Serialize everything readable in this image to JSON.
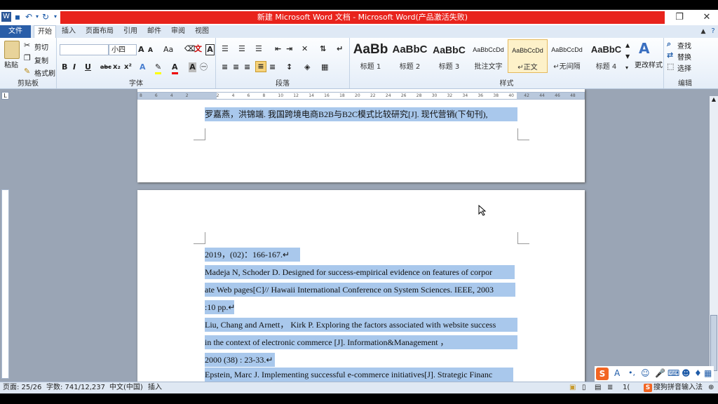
{
  "window": {
    "title": "新建 Microsoft Word 文档 - Microsoft Word(产品激活失败)",
    "restore_icon": "restore-icon",
    "close_icon": "close-icon"
  },
  "ribbon_tabs": [
    "文件",
    "开始",
    "插入",
    "页面布局",
    "引用",
    "邮件",
    "审阅",
    "视图"
  ],
  "clipboard": {
    "paste": "粘贴",
    "cut": "剪切",
    "copy": "复制",
    "format_painter": "格式刷",
    "label": "剪贴板"
  },
  "font": {
    "family_value": "",
    "size_value": "小四",
    "label": "字体",
    "bold": "B",
    "italic": "I",
    "underline": "U",
    "strike": "abc",
    "subscript": "x₂",
    "superscript": "x²",
    "grow": "A",
    "shrink": "A",
    "change_case": "Aa",
    "char_shading": "A",
    "enclose": "㊀"
  },
  "paragraph": {
    "label": "段落"
  },
  "styles": {
    "label": "样式",
    "items": [
      {
        "sample": "AaBb",
        "name": "标题 1"
      },
      {
        "sample": "AaBbC",
        "name": "标题 2"
      },
      {
        "sample": "AaBbC",
        "name": "标题 3"
      },
      {
        "sample": "AaBbCcDd",
        "name": "批注文字"
      },
      {
        "sample": "AaBbCcDd",
        "name": "↵正文"
      },
      {
        "sample": "AaBbCcDd",
        "name": "↵无间隔"
      },
      {
        "sample": "AaBbC",
        "name": "标题 4"
      }
    ],
    "change_styles": "更改样式"
  },
  "editing": {
    "label": "编辑",
    "find": "查找",
    "replace": "替换",
    "select": "选择"
  },
  "ruler": {
    "ticks": [
      "8",
      "6",
      "4",
      "2",
      "",
      "2",
      "4",
      "6",
      "8",
      "10",
      "12",
      "14",
      "16",
      "18",
      "20",
      "22",
      "24",
      "26",
      "28",
      "30",
      "32",
      "34",
      "36",
      "38",
      "40",
      "42",
      "44",
      "46",
      "48"
    ]
  },
  "document": {
    "page1_lines": [
      "罗嘉燕，洪锦端. 我国跨境电商B2B与B2C模式比较研究[J]. 现代营销(下旬刊),"
    ],
    "page2_lines": [
      "2019，(02)：166-167.↵",
      "Madeja N, Schoder D. Designed for success-empirical evidence on features of corpor",
      "ate Web pages[C]// Hawaii International Conference on System Sciences. IEEE, 2003",
      ":10 pp.↵",
      "Liu, Chang and Arnett， Kirk P. Exploring the factors associated with website success",
      " in the context of electronic commerce [J]. Information&Management ，",
      "2000 (38) : 23-33.↵",
      "Epstein, Marc J. Implementing successful e-commerce initiatives[J]. Strategic Financ"
    ]
  },
  "status": {
    "page": "页面: 25/26",
    "words": "字数: 741/12,237",
    "language": "中文(中国)",
    "mode": "插入",
    "zoom_partial": "1("
  },
  "ime": {
    "name": "搜狗拼音输入法",
    "logo": "S"
  }
}
